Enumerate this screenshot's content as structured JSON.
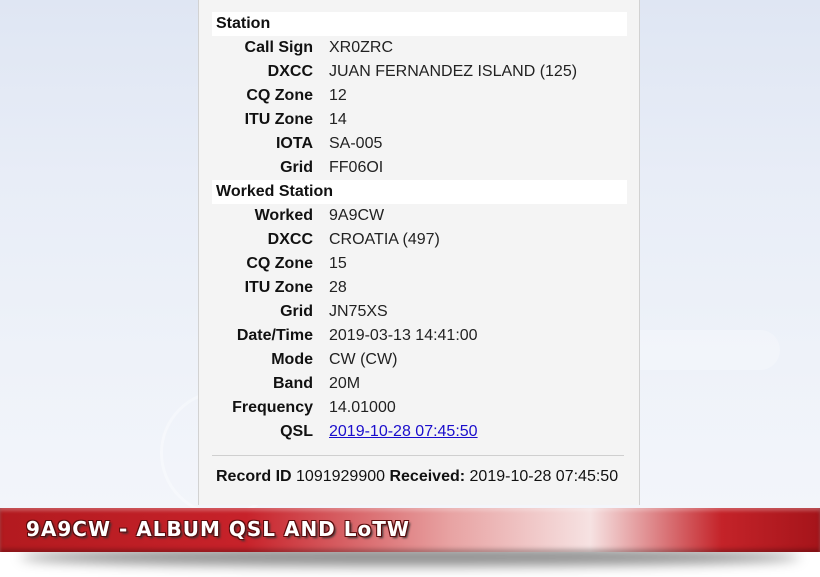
{
  "station": {
    "heading": "Station",
    "rows": [
      {
        "label": "Call Sign",
        "value": "XR0ZRC"
      },
      {
        "label": "DXCC",
        "value": "JUAN FERNANDEZ ISLAND (125)"
      },
      {
        "label": "CQ Zone",
        "value": "12"
      },
      {
        "label": "ITU Zone",
        "value": "14"
      },
      {
        "label": "IOTA",
        "value": "SA-005"
      },
      {
        "label": "Grid",
        "value": "FF06OI"
      }
    ]
  },
  "worked_station": {
    "heading": "Worked Station",
    "rows": [
      {
        "label": "Worked",
        "value": "9A9CW"
      },
      {
        "label": "DXCC",
        "value": "CROATIA (497)"
      },
      {
        "label": "CQ Zone",
        "value": "15"
      },
      {
        "label": "ITU Zone",
        "value": "28"
      },
      {
        "label": "Grid",
        "value": "JN75XS"
      },
      {
        "label": "Date/Time",
        "value": "2019-03-13 14:41:00"
      },
      {
        "label": "Mode",
        "value": "CW (CW)"
      },
      {
        "label": "Band",
        "value": "20M"
      },
      {
        "label": "Frequency",
        "value": "14.01000"
      },
      {
        "label": "QSL",
        "value": "2019-10-28 07:45:50"
      }
    ]
  },
  "record": {
    "id_label": "Record ID",
    "id_value": "1091929900",
    "received_label": "Received:",
    "received_value": "2019-10-28 07:45:50"
  },
  "banner": {
    "title": "9A9CW - ALBUM QSL AND LoTW"
  },
  "colors": {
    "banner_red": "#c7222a",
    "link": "#1a0dcc"
  }
}
